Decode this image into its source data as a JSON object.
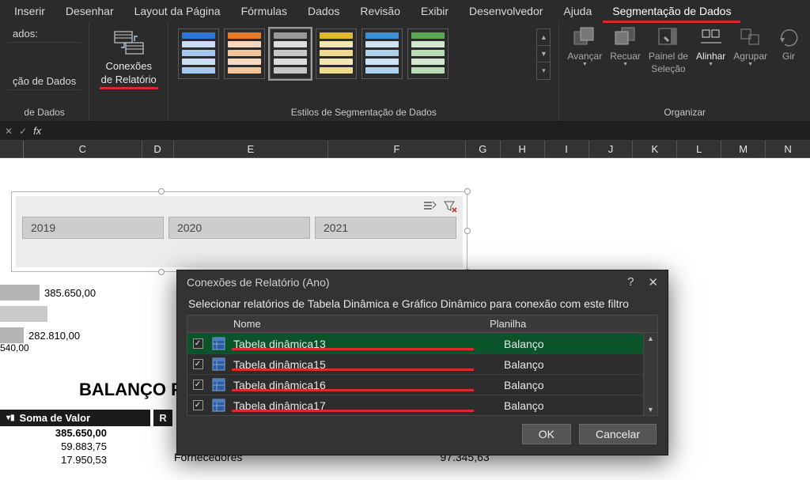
{
  "tabs": {
    "t0": "Inserir",
    "t1": "Desenhar",
    "t2": "Layout da Página",
    "t3": "Fórmulas",
    "t4": "Dados",
    "t5": "Revisão",
    "t6": "Exibir",
    "t7": "Desenvolvedor",
    "t8": "Ajuda",
    "t9": "Segmentação de Dados"
  },
  "ribbon": {
    "caption_line1": "ados:",
    "caption_line2": "ção de Dados",
    "caption_group": "de Dados",
    "conexoes_l1": "Conexões",
    "conexoes_l2": "de Relatório",
    "styles_group": "Estilos de Segmentação de Dados",
    "arrange_group": "Organizar",
    "arrange": {
      "avancar": "Avançar",
      "recuar": "Recuar",
      "painel_l1": "Painel de",
      "painel_l2": "Seleção",
      "alinhar": "Alinhar",
      "agrupar": "Agrupar",
      "girar": "Gir"
    }
  },
  "formula_bar": {
    "fx": "fx"
  },
  "columns": {
    "C": "C",
    "D": "D",
    "E": "E",
    "F": "F",
    "G": "G",
    "H": "H",
    "I": "I",
    "J": "J",
    "K": "K",
    "L": "L",
    "M": "M",
    "N": "N"
  },
  "slicer": {
    "y2019": "2019",
    "y2020": "2020",
    "y2021": "2021"
  },
  "bars": {
    "v_top": "385.650,00",
    "v_mid": "282.810,00",
    "axis": "540,00"
  },
  "balanco_title": "BALANÇO PAT",
  "pivot": {
    "soma_hdr": "Soma de Valor",
    "hdr_r": "R",
    "r1": "385.650,00",
    "r2": "59.883,75",
    "r3": "17.950,53",
    "ext_label": "Fornecedores",
    "ext_value": "97.345,63"
  },
  "dialog": {
    "title": "Conexões de Relatório (Ano)",
    "subtitle": "Selecionar relatórios de Tabela Dinâmica e Gráfico Dinâmico para conexão com este filtro",
    "col_name": "Nome",
    "col_sheet": "Planilha",
    "rows": [
      {
        "name": "Tabela dinâmica13",
        "sheet": "Balanço"
      },
      {
        "name": "Tabela dinâmica15",
        "sheet": "Balanço"
      },
      {
        "name": "Tabela dinâmica16",
        "sheet": "Balanço"
      },
      {
        "name": "Tabela dinâmica17",
        "sheet": "Balanço"
      }
    ],
    "ok": "OK",
    "cancel": "Cancelar"
  },
  "styles": {
    "palette": [
      {
        "head": "#2e75d6",
        "rows": [
          "#c9ddf5",
          "#a6c7ee",
          "#c9ddf5",
          "#a6c7ee"
        ]
      },
      {
        "head": "#e87b2a",
        "rows": [
          "#f7d9bf",
          "#f2c49a",
          "#f7d9bf",
          "#f2c49a"
        ]
      },
      {
        "head": "#9a9a9a",
        "rows": [
          "#dcdcdc",
          "#c6c6c6",
          "#dcdcdc",
          "#c6c6c6"
        ]
      },
      {
        "head": "#e0b92e",
        "rows": [
          "#f3e6b2",
          "#edda8f",
          "#f3e6b2",
          "#edda8f"
        ]
      },
      {
        "head": "#3f8fd6",
        "rows": [
          "#cde2f3",
          "#aed1ec",
          "#cde2f3",
          "#aed1ec"
        ]
      },
      {
        "head": "#5aa856",
        "rows": [
          "#d1e8cf",
          "#b8dcb5",
          "#d1e8cf",
          "#b8dcb5"
        ]
      }
    ]
  }
}
